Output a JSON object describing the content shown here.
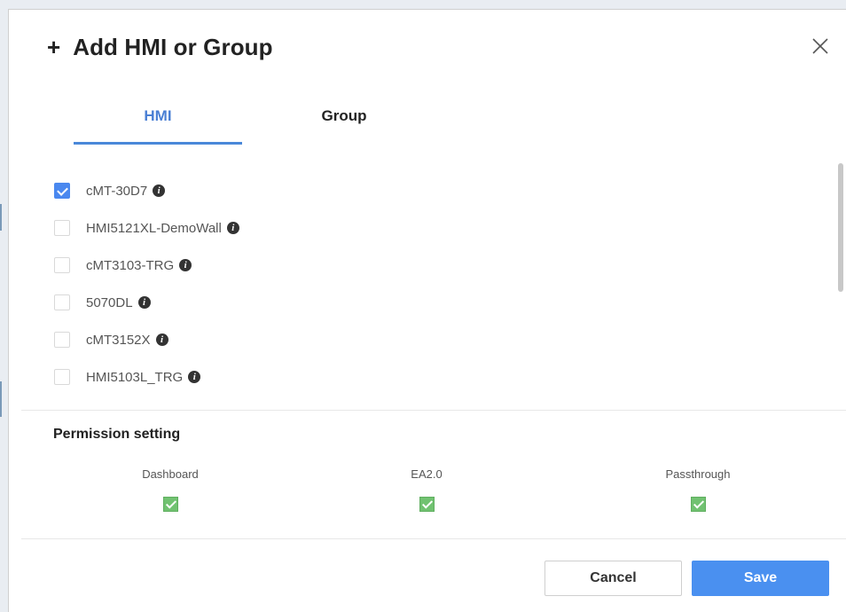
{
  "dialog": {
    "title": "Add HMI or Group",
    "title_icon": "plus-icon",
    "close_icon": "close-icon"
  },
  "tabs": [
    {
      "label": "HMI",
      "active": true
    },
    {
      "label": "Group",
      "active": false
    }
  ],
  "hmi_list": [
    {
      "label": "cMT-30D7",
      "checked": true,
      "icon": "info-icon"
    },
    {
      "label": "HMI5121XL-DemoWall",
      "checked": false,
      "icon": "info-icon"
    },
    {
      "label": "cMT3103-TRG",
      "checked": false,
      "icon": "info-icon"
    },
    {
      "label": "5070DL",
      "checked": false,
      "icon": "info-icon"
    },
    {
      "label": "cMT3152X",
      "checked": false,
      "icon": "info-icon"
    },
    {
      "label": "HMI5103L_TRG",
      "checked": false,
      "icon": "info-icon"
    }
  ],
  "permission": {
    "title": "Permission setting",
    "items": [
      {
        "label": "Dashboard",
        "checked": true
      },
      {
        "label": "EA2.0",
        "checked": true
      },
      {
        "label": "Passthrough",
        "checked": true
      }
    ]
  },
  "buttons": {
    "cancel_label": "Cancel",
    "save_label": "Save"
  },
  "colors": {
    "accent": "#4a88ef",
    "permission_check": "#71c271",
    "save_button": "#4a90f0"
  }
}
